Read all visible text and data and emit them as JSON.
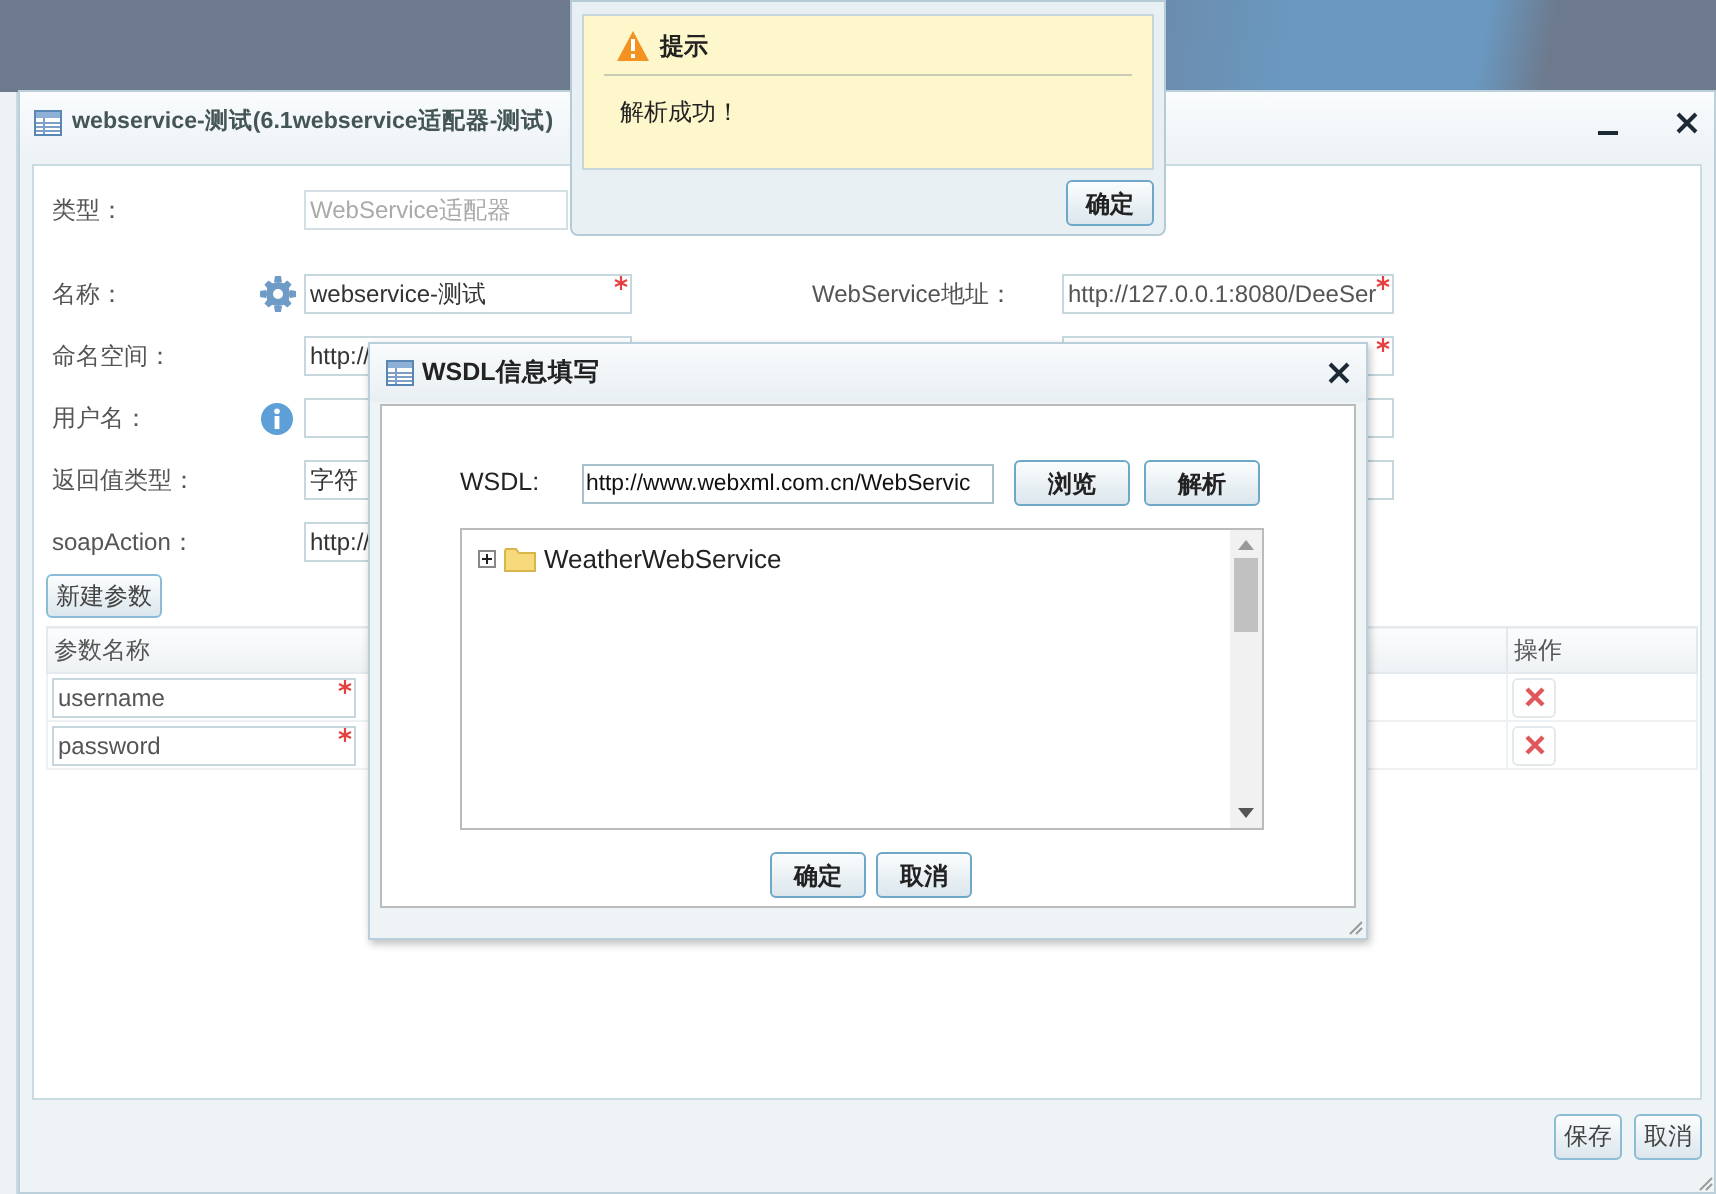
{
  "main_window": {
    "title": "webservice-测试(6.1webservice适配器-测试)",
    "form_rows": [
      {
        "label": "类型：",
        "value": "WebService适配器",
        "disabled": true,
        "required": false
      },
      {
        "label": "名称：",
        "value": "webservice-测试",
        "disabled": false,
        "required": true
      },
      {
        "label": "命名空间：",
        "value": "http://",
        "disabled": false,
        "required": false
      },
      {
        "label": "用户名：",
        "disabled": false,
        "required": false
      },
      {
        "label": "返回值类型：",
        "value": "字符",
        "disabled": false,
        "required": false
      },
      {
        "label": "soapAction：",
        "value": "http://",
        "disabled": false,
        "required": false
      }
    ],
    "right_fields": [
      {
        "label": "WebService地址：",
        "value": "http://127.0.0.1:8080/DeeSer",
        "required": true
      },
      {
        "required": true
      },
      {
        "required": false
      },
      {
        "required": false
      }
    ],
    "new_param_button": "新建参数",
    "params_table": {
      "columns": [
        "参数名称",
        "操作"
      ],
      "rows": [
        {
          "name": "username",
          "required": true
        },
        {
          "name": "password",
          "required": true
        }
      ]
    },
    "buttons": [
      "保存",
      "取消"
    ]
  },
  "wsdl_dialog": {
    "title": "WSDL信息填写",
    "wsdl_label": "WSDL:",
    "wsdl_value": "http://www.webxml.com.cn/WebServic",
    "action_buttons": [
      "浏览",
      "解析"
    ],
    "tree": [
      {
        "label": "WeatherWebService",
        "expanded": false
      }
    ],
    "buttons": [
      "确定",
      "取消"
    ]
  },
  "alert": {
    "title": "提示",
    "message": "解析成功！",
    "button": "确定"
  }
}
